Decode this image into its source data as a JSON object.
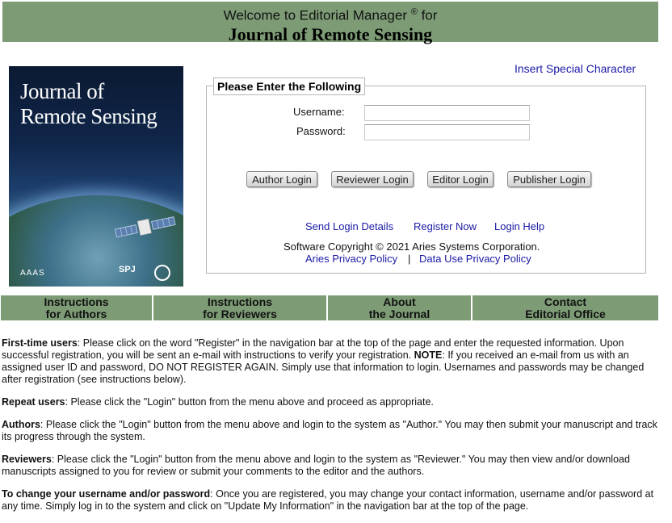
{
  "header": {
    "welcome": "Welcome to Editorial Manager",
    "registered": "®",
    "for": "for",
    "journal": "Journal of Remote Sensing"
  },
  "cover": {
    "title_line1": "Journal of",
    "title_line2": "Remote Sensing",
    "publisher_left": "AAAS",
    "publisher_right": "SPJ"
  },
  "insert_special_character": "Insert Special Character",
  "login": {
    "legend": "Please Enter the Following",
    "username_label": "Username:",
    "password_label": "Password:",
    "buttons": {
      "author": "Author Login",
      "reviewer": "Reviewer Login",
      "editor": "Editor Login",
      "publisher": "Publisher Login"
    },
    "links": {
      "send_login": "Send Login Details",
      "register": "Register Now",
      "help": "Login Help"
    },
    "copyright": "Software Copyright © 2021 Aries Systems Corporation.",
    "aries_privacy": "Aries Privacy Policy",
    "separator": "|",
    "data_privacy": "Data Use Privacy Policy"
  },
  "nav": [
    {
      "line1": "Instructions",
      "line2": "for Authors"
    },
    {
      "line1": "Instructions",
      "line2": "for Reviewers"
    },
    {
      "line1": "About",
      "line2": "the Journal"
    },
    {
      "line1": "Contact",
      "line2": "Editorial Office"
    }
  ],
  "content": {
    "first_label": "First-time users",
    "first_text_a": ": Please click on the word \"Register\" in the navigation bar at the top of the page and enter the requested information. Upon successful registration, you will be sent an e-mail with instructions to verify your registration. ",
    "first_note": "NOTE",
    "first_text_b": ": If you received an e-mail from us with an assigned user ID and password, DO NOT REGISTER AGAIN. Simply use that information to login. Usernames and passwords may be changed after registration (see instructions below).",
    "repeat_label": "Repeat users",
    "repeat_text": ": Please click the \"Login\" button from the menu above and proceed as appropriate.",
    "authors_label": "Authors",
    "authors_text": ": Please click the \"Login\" button from the menu above and login to the system as \"Author.\" You may then submit your manuscript and track its progress through the system.",
    "reviewers_label": "Reviewers",
    "reviewers_text": ": Please click the \"Login\" button from the menu above and login to the system as \"Reviewer.\" You may then view and/or download manuscripts assigned to you for review or submit your comments to the editor and the authors.",
    "change_label": "To change your username and/or password",
    "change_text": ": Once you are registered, you may change your contact information, username and/or password at any time. Simply log in to the system and click on \"Update My Information\" in the navigation bar at the top of the page."
  }
}
